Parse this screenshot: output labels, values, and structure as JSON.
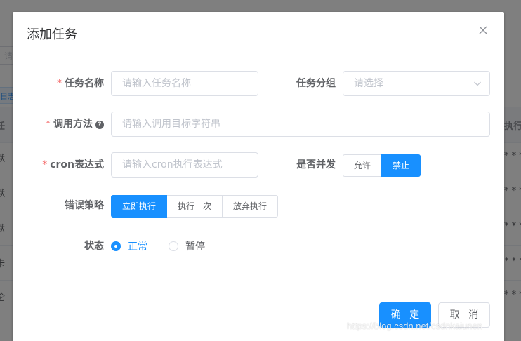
{
  "background": {
    "search_stub": "请",
    "button_stub": "日志",
    "left_rows": [
      "任",
      "默",
      "默",
      "默",
      "卡",
      "伦"
    ],
    "right_rows": [
      "执行表",
      "* * *",
      "* * *",
      "* * *",
      "* * *",
      "* * *"
    ]
  },
  "dialog": {
    "title": "添加任务",
    "form": {
      "task_name": {
        "label": "任务名称",
        "required": "*",
        "placeholder": "请输入任务名称"
      },
      "task_group": {
        "label": "任务分组",
        "placeholder": "请选择"
      },
      "invoke_target": {
        "label": "调用方法",
        "required": "*",
        "help": "?",
        "placeholder": "请输入调用目标字符串"
      },
      "cron": {
        "label": "cron表达式",
        "required": "*",
        "placeholder": "请输入cron执行表达式"
      },
      "concurrent": {
        "label": "是否并发",
        "options": [
          "允许",
          "禁止"
        ],
        "selected": "禁止"
      },
      "misfire": {
        "label": "错误策略",
        "options": [
          "立即执行",
          "执行一次",
          "放弃执行"
        ],
        "selected": "立即执行"
      },
      "status": {
        "label": "状态",
        "options": [
          "正常",
          "暂停"
        ],
        "selected": "正常"
      }
    },
    "footer": {
      "confirm": "确 定",
      "cancel": "取 消"
    }
  },
  "watermark": "https://blog.csdn.net/csdnkaiunen",
  "colors": {
    "primary": "#1890ff",
    "required": "#f56c6c",
    "border": "#dcdfe6",
    "overlay": "rgba(0,0,0,0.5)"
  }
}
